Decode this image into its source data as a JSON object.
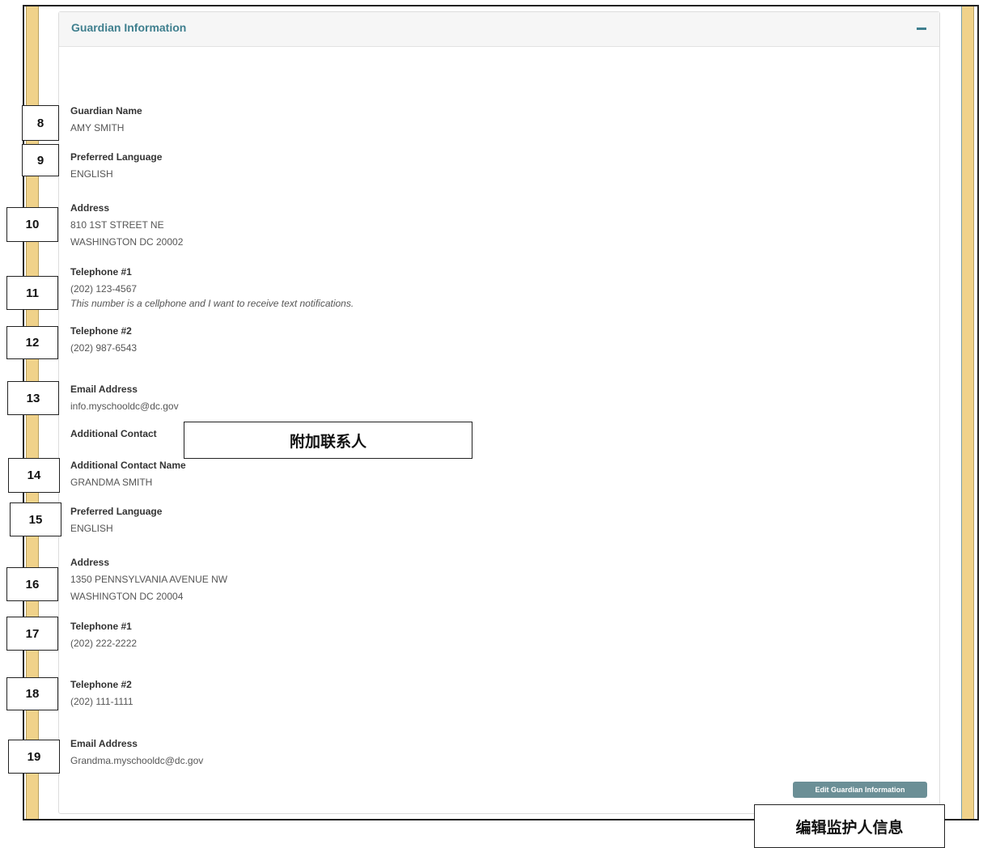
{
  "panel": {
    "title": "Guardian Information",
    "collapse_symbol": "minus-icon",
    "edit_button": "Edit Guardian Information"
  },
  "guardian": {
    "name_label": "Guardian Name",
    "name": "AMY SMITH",
    "language_label": "Preferred Language",
    "language": "ENGLISH",
    "address_label": "Address",
    "address_line1": "810 1ST STREET NE",
    "address_line2": "WASHINGTON DC 20002",
    "tel1_label": "Telephone #1",
    "tel1": "(202) 123-4567",
    "tel1_note": "This number is a cellphone and I want to receive text notifications.",
    "tel2_label": "Telephone #2",
    "tel2": "(202) 987-6543",
    "email_label": "Email Address",
    "email": "info.myschooldc@dc.gov"
  },
  "additional": {
    "section_label": "Additional Contact",
    "name_label": "Additional Contact Name",
    "name": "GRANDMA SMITH",
    "language_label": "Preferred Language",
    "language": "ENGLISH",
    "address_label": "Address",
    "address_line1": "1350 PENNSYLVANIA AVENUE NW",
    "address_line2": "WASHINGTON DC 20004",
    "tel1_label": "Telephone #1",
    "tel1": "(202) 222-2222",
    "tel2_label": "Telephone #2",
    "tel2": "(202) 111-1111",
    "email_label": "Email Address",
    "email": "Grandma.myschooldc@dc.gov"
  },
  "annotations": {
    "numbers": [
      "8",
      "9",
      "10",
      "11",
      "12",
      "13",
      "14",
      "15",
      "16",
      "17",
      "18",
      "19"
    ],
    "additional_contact_cn": "附加联系人",
    "edit_guardian_cn": "编辑监护人信息"
  },
  "colors": {
    "accent": "#3f7f8e",
    "stripe": "#f0d28a",
    "button": "#6b8f96"
  }
}
